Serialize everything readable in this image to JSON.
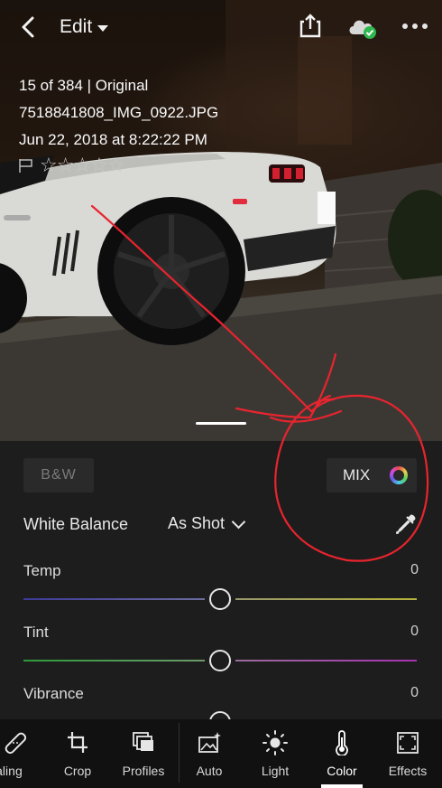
{
  "topbar": {
    "mode_label": "Edit",
    "icons": [
      "back-icon",
      "caret-down-icon",
      "share-icon",
      "cloud-synced-icon",
      "more-icon"
    ]
  },
  "photo_info": {
    "counter": "15 of 384 | Original",
    "filename": "7518841808_IMG_0922.JPG",
    "datetime": "Jun 22, 2018 at 8:22:22 PM",
    "stars": "☆☆☆☆☆",
    "rating": 0
  },
  "panel": {
    "bw_label": "B&W",
    "mix_label": "MIX",
    "white_balance": {
      "label": "White Balance",
      "value": "As Shot"
    },
    "sliders": [
      {
        "label": "Temp",
        "value": "0"
      },
      {
        "label": "Tint",
        "value": "0"
      },
      {
        "label": "Vibrance",
        "value": "0"
      }
    ]
  },
  "toolbar": {
    "tools": [
      {
        "label": "Healing",
        "icon": "bandage-icon"
      },
      {
        "label": "Crop",
        "icon": "crop-icon"
      },
      {
        "label": "Profiles",
        "icon": "profiles-icon"
      },
      {
        "label": "Auto",
        "icon": "auto-icon"
      },
      {
        "label": "Light",
        "icon": "sun-icon"
      },
      {
        "label": "Color",
        "icon": "thermometer-icon"
      },
      {
        "label": "Effects",
        "icon": "effects-icon"
      }
    ],
    "active": "Color"
  },
  "colors": {
    "annotation": "#e8242e",
    "panel_bg": "#1d1d1d",
    "toolbar_bg": "#111111",
    "cloud_check": "#2fb84f"
  }
}
